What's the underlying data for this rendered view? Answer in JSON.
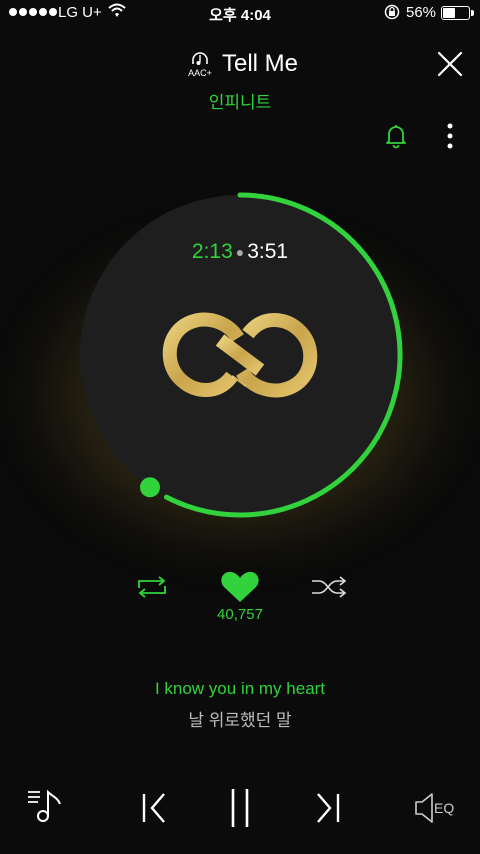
{
  "status_bar": {
    "carrier": "LG U+",
    "time": "오후 4:04",
    "battery_percent": "56%",
    "battery_level": 0.56
  },
  "player": {
    "codec_label": "AAC+",
    "song_title": "Tell Me",
    "artist": "인피니트",
    "elapsed": "2:13",
    "duration": "3:51",
    "progress_fraction": 0.576,
    "like_count": "40,757",
    "lyrics": {
      "current_line": "I know you in my heart",
      "next_line": "날 위로했던 말"
    },
    "eq_label": "EQ"
  },
  "colors": {
    "accent": "#32d23c",
    "background": "#0b0b0b",
    "dial": "#1e1e1e",
    "logo_gold": "#d8b95c"
  },
  "icons": [
    "signal-dots-icon",
    "wifi-icon",
    "rotation-lock-icon",
    "battery-icon",
    "headphone-aac-icon",
    "close-icon",
    "bell-icon",
    "more-vertical-icon",
    "repeat-icon",
    "heart-icon",
    "shuffle-icon",
    "playlist-icon",
    "previous-icon",
    "pause-icon",
    "next-icon",
    "equalizer-icon"
  ]
}
